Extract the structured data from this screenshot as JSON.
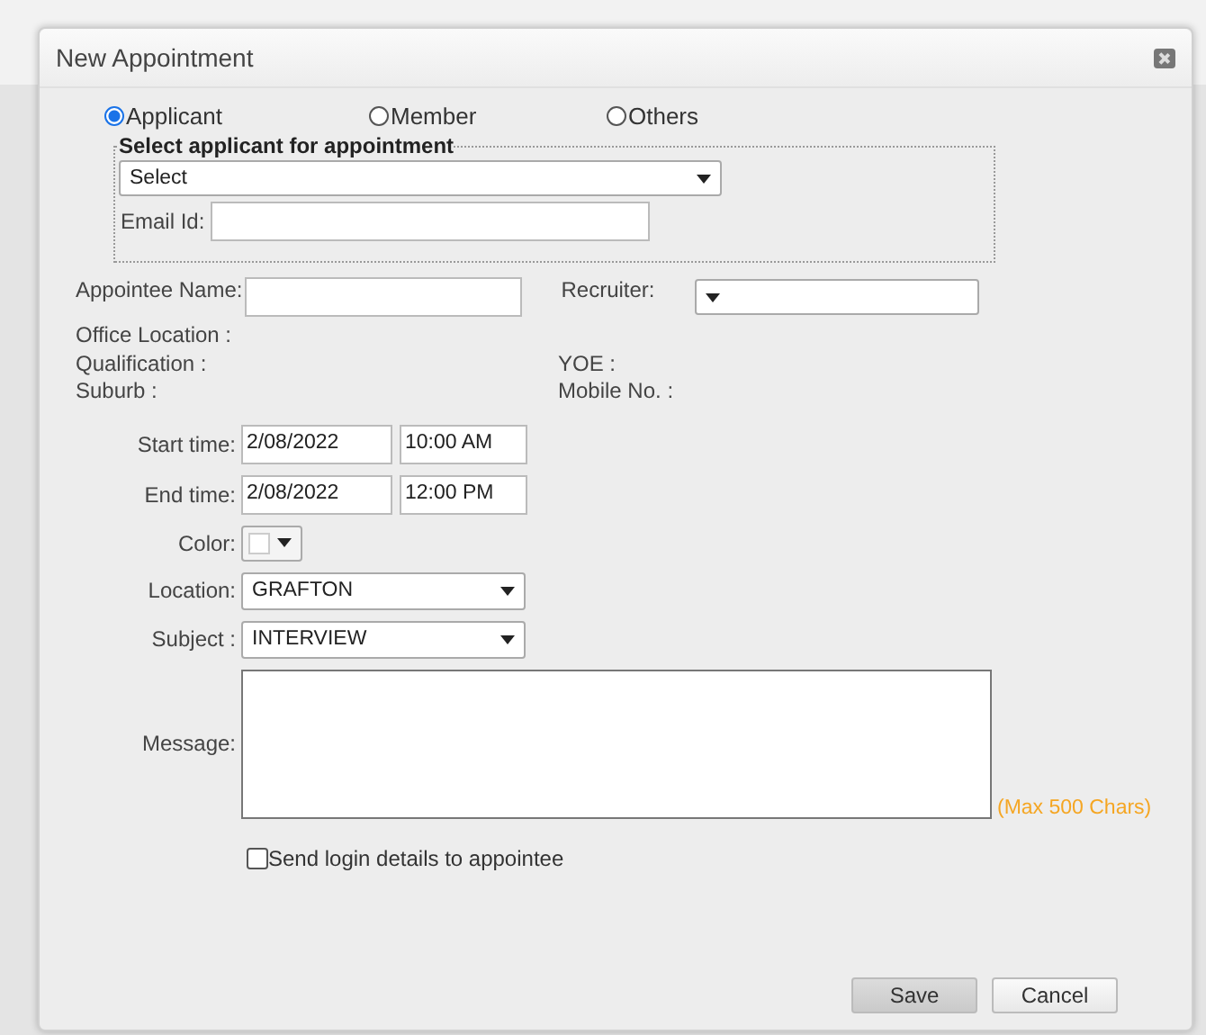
{
  "dialog": {
    "title": "New Appointment"
  },
  "target_options": [
    {
      "label": "Applicant",
      "selected": true
    },
    {
      "label": "Member",
      "selected": false
    },
    {
      "label": "Others",
      "selected": false
    }
  ],
  "applicant_group": {
    "legend": "Select applicant for appointment",
    "select": {
      "value": "Select"
    },
    "email": {
      "label": "Email Id:"
    }
  },
  "appointee": {
    "name_label": "Appointee Name:",
    "recruiter_label": "Recruiter:"
  },
  "info_rows": [
    {
      "left": "Office Location :"
    },
    {
      "left": "Qualification :",
      "right": "YOE :"
    },
    {
      "left": "Suburb :",
      "right": "Mobile No. :"
    }
  ],
  "schedule": [
    {
      "kind": "datetime",
      "label": "Start time:",
      "date": "2/08/2022",
      "time": "10:00 AM"
    },
    {
      "kind": "datetime",
      "label": "End time:",
      "date": "2/08/2022",
      "time": "12:00 PM"
    },
    {
      "kind": "color",
      "label": "Color:",
      "color": "#ffffff"
    },
    {
      "kind": "dropdown",
      "label": "Location:",
      "value": "GRAFTON"
    },
    {
      "kind": "dropdown",
      "label": "Subject :",
      "value": "INTERVIEW"
    },
    {
      "kind": "textarea",
      "label": "Message:",
      "hint": "(Max 500 Chars)"
    }
  ],
  "send_login": {
    "label": "Send login details to appointee",
    "checked": false
  },
  "buttons": [
    {
      "label": "Save",
      "kind": "primary"
    },
    {
      "label": "Cancel",
      "kind": "secondary"
    }
  ]
}
